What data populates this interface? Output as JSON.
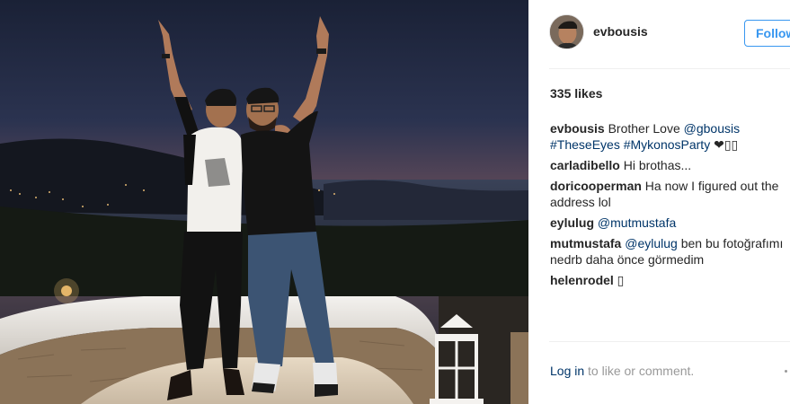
{
  "post": {
    "username": "evbousis",
    "follow_label": "Follow",
    "likes": "335 likes",
    "caption": {
      "user": "evbousis",
      "text": " Brother Love ",
      "mention": "@gbousis",
      "hashtags": "#TheseEyes #MykonosParty",
      "emoji": " ❤"
    },
    "comments": [
      {
        "user": "carladibello",
        "text": " Hi brothas..."
      },
      {
        "user": "doricooperman",
        "text": " Ha now I figured out the",
        "text2": "address lol"
      },
      {
        "user": "eylulug",
        "mention": " @mutmustafa"
      },
      {
        "user": "mutmustafa",
        "mention": " @eylulug",
        "text": " ben bu fotoğrafımı",
        "text2": "nedrb daha önce görmedim"
      },
      {
        "user": "helenrodel",
        "text": " ▯"
      }
    ],
    "login_link": "Log in",
    "login_rest": " to like or comment."
  }
}
